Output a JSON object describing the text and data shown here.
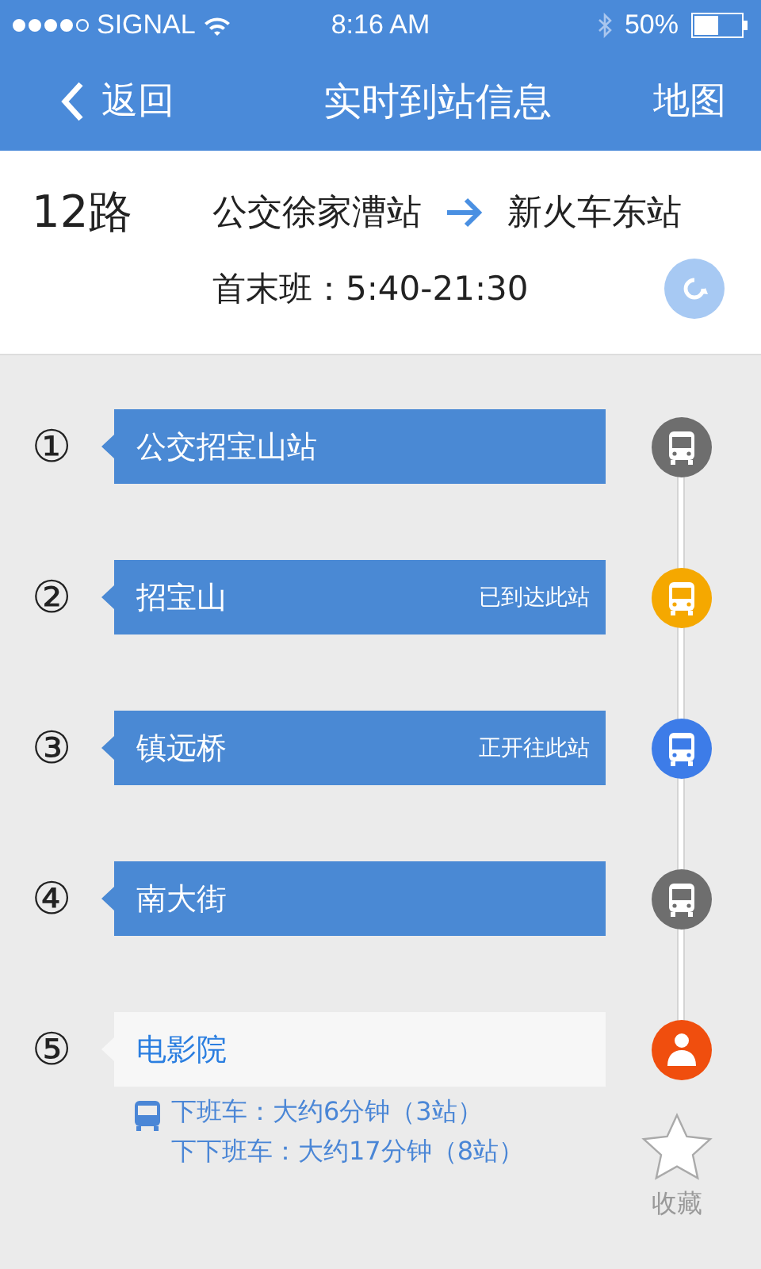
{
  "status_bar": {
    "carrier": "SIGNAL",
    "time": "8:16 AM",
    "battery": "50%"
  },
  "nav": {
    "back": "返回",
    "title": "实时到站信息",
    "map": "地图"
  },
  "route": {
    "name": "12路",
    "from": "公交徐家漕站",
    "to": "新火车东站",
    "hours": "首末班：5:40-21:30"
  },
  "stops": [
    {
      "number": "①",
      "name": "公交招宝山站",
      "kind": "bus",
      "color": "#6e6e6e",
      "selected": false
    },
    {
      "number": "②",
      "name": "招宝山",
      "status": "已到达此站",
      "kind": "bus",
      "color": "#f5a800",
      "selected": false
    },
    {
      "number": "③",
      "name": "镇远桥",
      "status": "正开往此站",
      "kind": "bus",
      "color": "#3d7ce8",
      "selected": false
    },
    {
      "number": "④",
      "name": "南大街",
      "kind": "bus",
      "color": "#6e6e6e",
      "selected": false
    },
    {
      "number": "⑤",
      "name": "电影院",
      "kind": "person",
      "color": "#f04e0e",
      "selected": true
    }
  ],
  "arrivals": [
    "下班车：大约6分钟（3站）",
    "下下班车：大约17分钟（8站）"
  ],
  "favorite": {
    "label": "收藏"
  }
}
